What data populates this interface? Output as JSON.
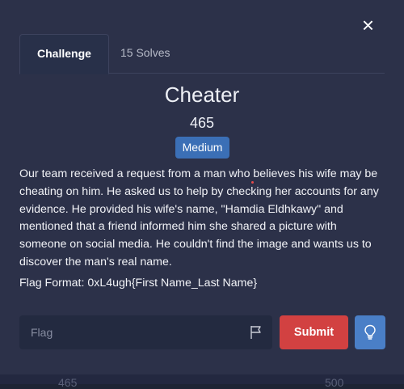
{
  "modal": {
    "close_icon": "×",
    "tabs": [
      {
        "label": "Challenge",
        "active": true
      },
      {
        "label": "15 Solves",
        "active": false
      }
    ],
    "challenge": {
      "title": "Cheater",
      "points": "465",
      "difficulty": "Medium",
      "description": "Our team received a request from a man who believes his wife may be cheating on him. He asked us to help by checking her accounts for any evidence. He provided his wife's name, \"Hamdia Eldhkawy\" and mentioned that a friend informed him she shared a picture with someone on social media. He couldn't find the image and wants us to discover the man's real name.",
      "flag_format": "Flag Format: 0xL4ugh{First Name_Last Name}"
    },
    "flag_input": {
      "placeholder": "Flag",
      "value": ""
    },
    "submit_label": "Submit",
    "hint_icon": "lightbulb-icon",
    "colors": {
      "modal_bg": "#2c3149",
      "badge": "#3b6fb6",
      "submit": "#d24141",
      "hint": "#4a7fc7"
    }
  },
  "background": {
    "partial_numbers": [
      "465",
      "500"
    ]
  }
}
